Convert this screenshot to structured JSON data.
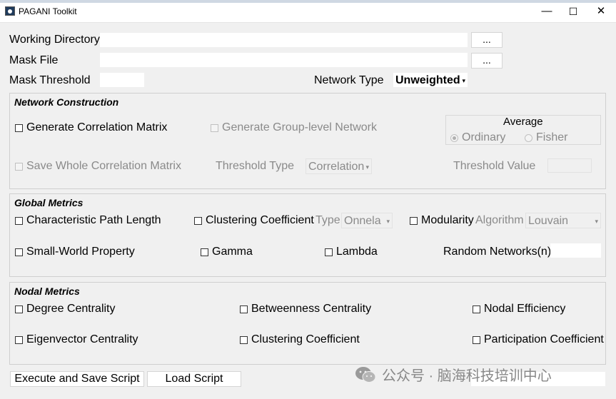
{
  "window": {
    "title": "PAGANI Toolkit",
    "minimize": "—",
    "maximize": "☐",
    "close": "✕"
  },
  "top": {
    "working_directory_label": "Working Directory",
    "working_directory_value": "",
    "browse_label": "...",
    "mask_file_label": "Mask File",
    "mask_file_value": "",
    "mask_threshold_label": "Mask Threshold",
    "mask_threshold_value": "",
    "network_type_label": "Network Type",
    "network_type_value": "Unweighted"
  },
  "network_construction": {
    "title": "Network Construction",
    "generate_correlation_matrix": "Generate Correlation Matrix",
    "generate_group_level_network": "Generate Group-level Network",
    "save_whole_correlation_matrix": "Save Whole Correlation Matrix",
    "threshold_type_label": "Threshold Type",
    "threshold_type_value": "Correlation",
    "threshold_value_label": "Threshold Value",
    "average": {
      "title": "Average",
      "ordinary": "Ordinary",
      "fisher": "Fisher"
    }
  },
  "global_metrics": {
    "title": "Global Metrics",
    "characteristic_path_length": "Characteristic Path Length",
    "clustering_coefficient": "Clustering Coefficient",
    "type_label": "Type",
    "type_value": "Onnela",
    "modularity": "Modularity",
    "algorithm_label": "Algorithm",
    "algorithm_value": "Louvain",
    "small_world_property": "Small-World Property",
    "gamma": "Gamma",
    "lambda": "Lambda",
    "random_networks_label": "Random Networks(n)",
    "random_networks_value": ""
  },
  "nodal_metrics": {
    "title": "Nodal Metrics",
    "degree_centrality": "Degree Centrality",
    "betweenness_centrality": "Betweenness Centrality",
    "nodal_efficiency": "Nodal Efficiency",
    "eigenvector_centrality": "Eigenvector Centrality",
    "clustering_coefficient": "Clustering Coefficient",
    "participation_coefficient": "Participation Coefficient"
  },
  "bottom": {
    "execute_button": "Execute and Save Script",
    "load_button": "Load Script"
  },
  "watermark": {
    "text": "公众号 · 脑海科技培训中心"
  },
  "colors": {
    "background": "#f0f0f0",
    "disabled_text": "#8a8a8a",
    "input_background": "#ffffff"
  }
}
